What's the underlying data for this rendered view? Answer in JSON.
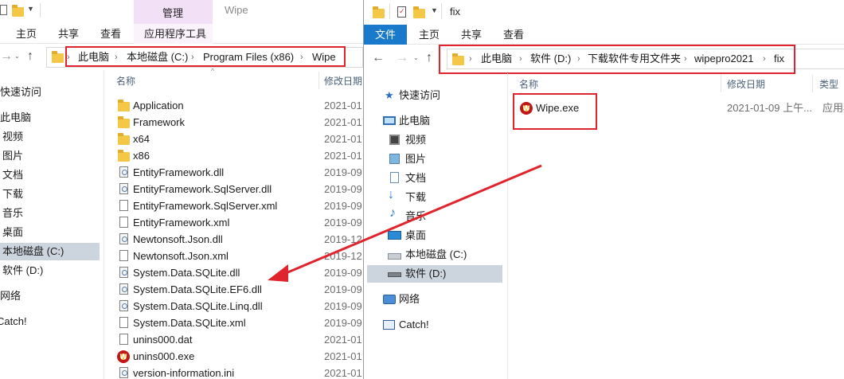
{
  "left": {
    "ribbon": {
      "tab_home": "主页",
      "tab_share": "共享",
      "tab_view": "查看",
      "context_group": "管理",
      "context_tab": "应用程序工具",
      "window_title": "Wipe"
    },
    "address": {
      "crumbs": [
        "此电脑",
        "本地磁盘 (C:)",
        "Program Files (x86)",
        "Wipe"
      ]
    },
    "columns": {
      "name": "名称",
      "modified": "修改日期"
    },
    "nav": [
      "快速访问",
      "此电脑",
      "视频",
      "图片",
      "文档",
      "下载",
      "音乐",
      "桌面",
      "本地磁盘 (C:)",
      "软件 (D:)",
      "网络",
      "Catch!"
    ],
    "files": [
      {
        "name": "Application",
        "date": "2021-01",
        "icon": "folder-icon"
      },
      {
        "name": "Framework",
        "date": "2021-01",
        "icon": "folder-icon"
      },
      {
        "name": "x64",
        "date": "2021-01",
        "icon": "folder-icon"
      },
      {
        "name": "x86",
        "date": "2021-01",
        "icon": "folder-icon"
      },
      {
        "name": "EntityFramework.dll",
        "date": "2019-09",
        "icon": "dll-icon"
      },
      {
        "name": "EntityFramework.SqlServer.dll",
        "date": "2019-09",
        "icon": "dll-icon"
      },
      {
        "name": "EntityFramework.SqlServer.xml",
        "date": "2019-09",
        "icon": "file-icon"
      },
      {
        "name": "EntityFramework.xml",
        "date": "2019-09",
        "icon": "file-icon"
      },
      {
        "name": "Newtonsoft.Json.dll",
        "date": "2019-12",
        "icon": "dll-icon"
      },
      {
        "name": "Newtonsoft.Json.xml",
        "date": "2019-12",
        "icon": "file-icon"
      },
      {
        "name": "System.Data.SQLite.dll",
        "date": "2019-09",
        "icon": "dll-icon"
      },
      {
        "name": "System.Data.SQLite.EF6.dll",
        "date": "2019-09",
        "icon": "dll-icon"
      },
      {
        "name": "System.Data.SQLite.Linq.dll",
        "date": "2019-09",
        "icon": "dll-icon"
      },
      {
        "name": "System.Data.SQLite.xml",
        "date": "2019-09",
        "icon": "file-icon"
      },
      {
        "name": "unins000.dat",
        "date": "2021-01",
        "icon": "file-icon"
      },
      {
        "name": "unins000.exe",
        "date": "2021-01",
        "icon": "wipe-icon"
      },
      {
        "name": "version-information.ini",
        "date": "2021-01",
        "icon": "dll-icon"
      }
    ]
  },
  "right": {
    "title": "fix",
    "ribbon": {
      "tab_file": "文件",
      "tab_home": "主页",
      "tab_share": "共享",
      "tab_view": "查看"
    },
    "address": {
      "crumbs": [
        "此电脑",
        "软件 (D:)",
        "下载软件专用文件夹",
        "wipepro2021",
        "fix"
      ]
    },
    "columns": {
      "name": "名称",
      "modified": "修改日期",
      "type": "类型"
    },
    "nav": [
      "快速访问",
      "此电脑",
      "视频",
      "图片",
      "文档",
      "下载",
      "音乐",
      "桌面",
      "本地磁盘 (C:)",
      "软件 (D:)",
      "网络",
      "Catch!"
    ],
    "files": [
      {
        "name": "Wipe.exe",
        "date": "2021-01-09 上午...",
        "type": "应用程",
        "icon": "wipe-icon"
      }
    ]
  },
  "colors": {
    "ribbon_file_tab": "#1979ca",
    "context_tab": "#f2e1f6",
    "highlight_box": "#e0242d",
    "selection": "#ccd4de"
  }
}
